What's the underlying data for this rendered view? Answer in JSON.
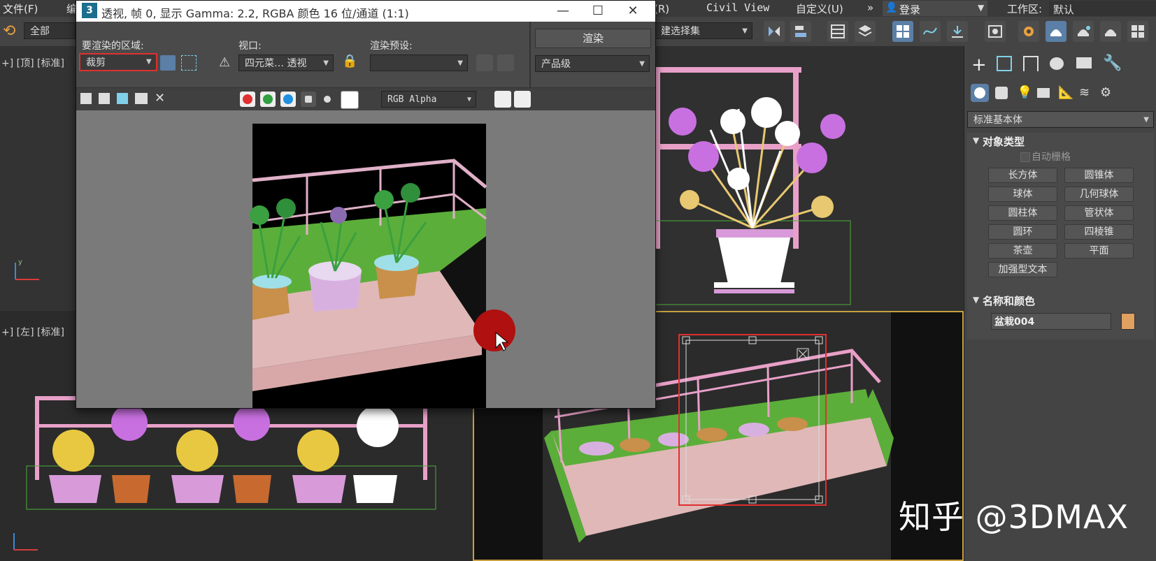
{
  "menubar": {
    "file": "文件(F)",
    "frag1": "编",
    "frag2": "菜(R)",
    "civil_view": "Civil View",
    "customize": "自定义(U)",
    "more": "»",
    "login": "登录",
    "workspace_label": "工作区:",
    "workspace_value": "默认"
  },
  "toolbar": {
    "filter_value": "全部",
    "selection_set": "建选择集"
  },
  "viewports": {
    "top_left_label": "+] [顶] [标准]",
    "bottom_left_label": "+] [左] [标准]"
  },
  "render_window": {
    "title": "透视, 帧 0, 显示 Gamma: 2.2, RGBA 颜色 16 位/通道 (1:1)",
    "area_label": "要渲染的区域:",
    "area_value": "裁剪",
    "viewport_label": "视口:",
    "viewport_value": "四元菜… 透视",
    "preset_label": "渲染预设:",
    "preset_value": "",
    "render_button": "渲染",
    "quality_value": "产品级",
    "channel_value": "RGB Alpha"
  },
  "command_panel": {
    "category_value": "标准基本体",
    "object_type_title": "对象类型",
    "autogrid": "自动栅格",
    "buttons": [
      "长方体",
      "圆锥体",
      "球体",
      "几何球体",
      "圆柱体",
      "管状体",
      "圆环",
      "四棱锥",
      "茶壶",
      "平面",
      "加强型文本"
    ],
    "name_color_title": "名称和颜色",
    "object_name": "盆栽004",
    "object_color": "#e0a060"
  },
  "watermark": "知乎 @3DMAX",
  "colors": {
    "pink_rail": "#e8a0c8",
    "grass": "#5cae3a",
    "floor": "#e0b8b8",
    "highlight_red": "#e03030",
    "accent_blue": "#5b7fa6"
  }
}
